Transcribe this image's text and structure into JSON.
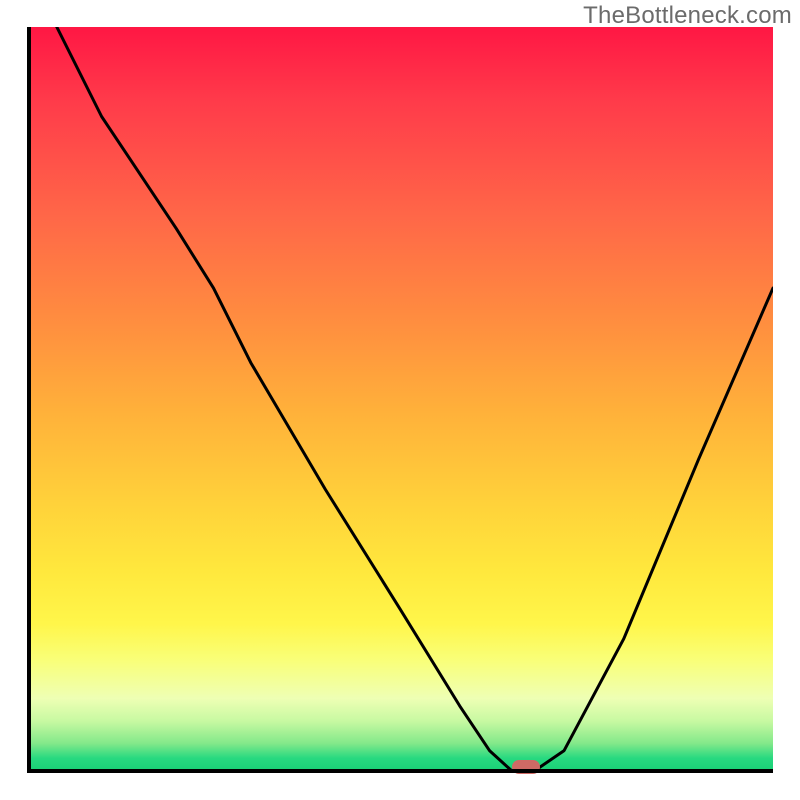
{
  "watermark": "TheBottleneck.com",
  "colors": {
    "top": "#ff1744",
    "mid_upper": "#ff8f3f",
    "mid_lower": "#ffe83d",
    "bottom": "#17cf74",
    "curve": "#000000",
    "axis": "#000000",
    "marker": "#cf6a65"
  },
  "chart_data": {
    "type": "line",
    "title": "",
    "xlabel": "",
    "ylabel": "",
    "xlim": [
      0,
      100
    ],
    "ylim": [
      0,
      100
    ],
    "x": [
      4,
      10,
      20,
      25,
      30,
      40,
      50,
      58,
      62,
      65,
      68,
      72,
      80,
      90,
      100
    ],
    "values": [
      100,
      88,
      73,
      65,
      55,
      38,
      22,
      9,
      3,
      0,
      0,
      3,
      18,
      42,
      65
    ],
    "marker": {
      "x": 67,
      "y": 0
    },
    "notes": "V-shaped bottleneck curve over a vertical red→green gradient background; black axes on left and bottom; single salmon pill marker at the trough."
  }
}
